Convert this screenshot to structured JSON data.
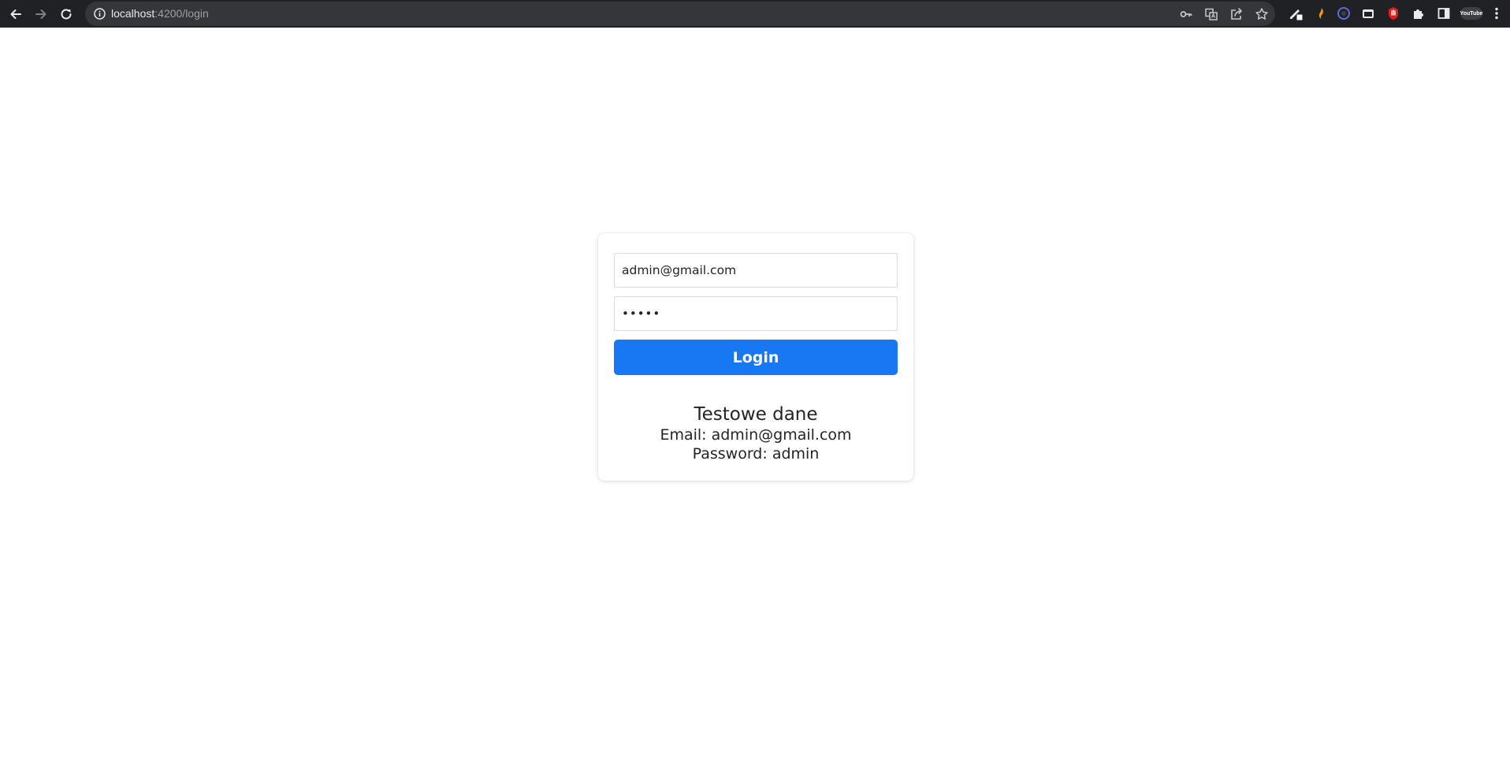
{
  "browser": {
    "url_host": "localhost",
    "url_rest": ":4200/login",
    "extension_badge": "YouTube"
  },
  "login_form": {
    "email_value": "admin@gmail.com",
    "password_value": "•••••",
    "login_label": "Login"
  },
  "test_data": {
    "title": "Testowe dane",
    "email_line": "Email: admin@gmail.com",
    "password_line": "Password: admin"
  },
  "colors": {
    "accent": "#1877f2",
    "chrome_bg": "#202124",
    "omnibox_bg": "#35363a"
  },
  "icons": {
    "back": "back-arrow-icon",
    "forward": "forward-arrow-icon",
    "reload": "reload-icon",
    "site_info": "info-icon",
    "password_key": "key-icon",
    "translate": "translate-icon",
    "share": "share-icon",
    "bookmark": "star-icon",
    "extensions": "puzzle-icon",
    "side_panel": "side-panel-icon",
    "menu": "kebab-menu-icon"
  }
}
